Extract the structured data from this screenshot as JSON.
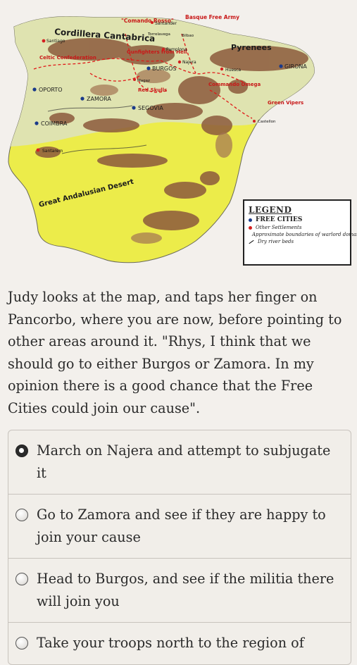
{
  "map": {
    "labels": {
      "cordillera": "Cordillera Cantabrica",
      "pyrenees": "Pyrenees",
      "desert": "Great Andalusian Desert",
      "comando_rosso": "\"Comando Rosso\"",
      "basque": "Basque Free Army",
      "santander": "Santander",
      "torrelavega": "Torrelavega",
      "bilbao": "Bilbao",
      "santiago": "Santiago",
      "celtic": "Celtic Confederation",
      "gunfighters": "Gunfighters from Hell",
      "pamplona": "Pamplona",
      "burgos": "BURGOS",
      "najera": "Najera",
      "huesca": "Huesca",
      "girona": "GIRONA",
      "oporto": "OPORTO",
      "zamora": "ZAMORA",
      "magaz": "Magaz",
      "red_skulls": "Red Skulls",
      "commando_omega": "Commando Omega",
      "segovia": "SEGOVIA",
      "green_vipers": "Green Vipers",
      "castellon": "Castellon",
      "coimbra": "COIMBRA",
      "santarem": "Santarem"
    },
    "legend": {
      "title": "LEGEND",
      "free_cities": "FREE CITIES",
      "other_settlements": "Other Settlements",
      "boundaries": "Approximate boundaries of warlord domains",
      "dry_river": "Dry river beds"
    },
    "colors": {
      "free_city": "#1a3a8a",
      "settlement": "#d42020",
      "boundary": "#e01818",
      "land_yellow": "#ecec4a",
      "land_green": "#d9e0a8",
      "mountain": "#8c5a3c"
    }
  },
  "story": {
    "text": "Judy looks at the map, and taps her finger on Pancorbo, where you are now, before pointing to other areas around it. \"Rhys, I think that we should go to either Burgos or Zamora. In my opinion there is a good chance that the Free Cities could join our cause\"."
  },
  "choices": [
    {
      "label": "March on Najera and attempt to subjugate it",
      "selected": true
    },
    {
      "label": "Go to Zamora and see if they are happy to join your cause",
      "selected": false
    },
    {
      "label": "Head to Burgos, and see if the militia there will join you",
      "selected": false
    },
    {
      "label": "Take your troops north to the region of",
      "selected": false
    }
  ]
}
